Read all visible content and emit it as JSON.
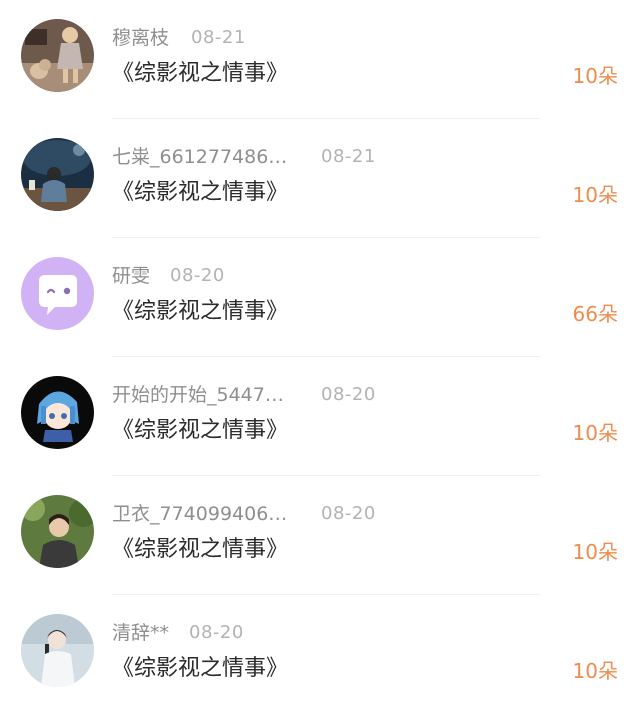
{
  "records": [
    {
      "name": "穆离枝",
      "date": "08-21",
      "gift": "《综影视之情事》",
      "count": "10朵",
      "avatar": "girl-figure-avatar"
    },
    {
      "name": "七粜_661277486…",
      "date": "08-21",
      "gift": "《综影视之情事》",
      "count": "10朵",
      "avatar": "night-scene-avatar"
    },
    {
      "name": "研雯",
      "date": "08-20",
      "gift": "《综影视之情事》",
      "count": "66朵",
      "avatar": "chat-bubble-avatar"
    },
    {
      "name": "开始的开始_5447…",
      "date": "08-20",
      "gift": "《综影视之情事》",
      "count": "10朵",
      "avatar": "anime-character-avatar"
    },
    {
      "name": "卫衣_774099406…",
      "date": "08-20",
      "gift": "《综影视之情事》",
      "count": "10朵",
      "avatar": "outdoor-portrait-avatar"
    },
    {
      "name": "清辞**",
      "date": "08-20",
      "gift": "《综影视之情事》",
      "count": "10朵",
      "avatar": "snow-portrait-avatar"
    }
  ],
  "colors": {
    "count_accent": "#ee8c4d",
    "name_gray": "#8f8f8f",
    "date_gray": "#b3b3b3",
    "gift_text": "#2b2b2b",
    "divider": "#f0f0f0"
  }
}
